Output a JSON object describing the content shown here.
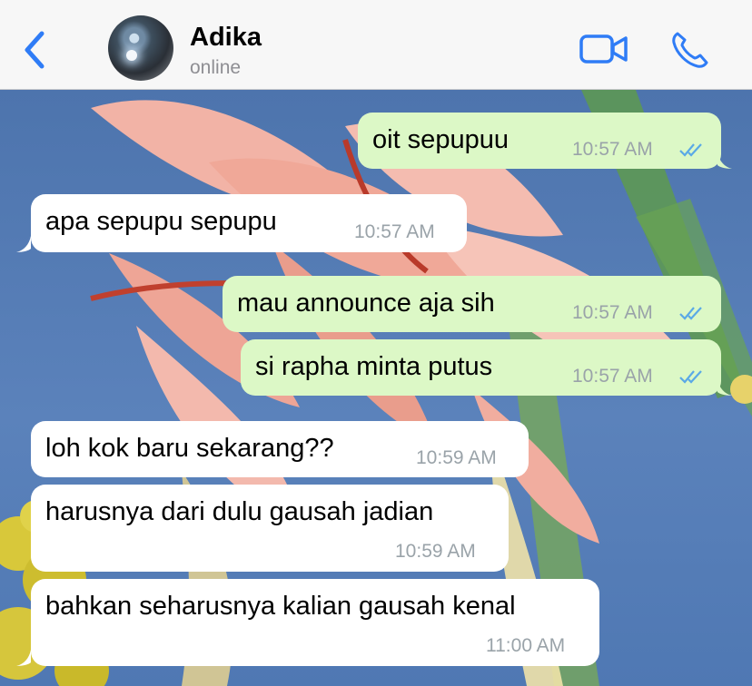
{
  "header": {
    "contact_name": "Adika",
    "contact_status": "online"
  },
  "icons": {
    "back": "chevron-left-icon",
    "video": "video-camera-icon",
    "call": "phone-icon",
    "read_receipt": "double-check-icon"
  },
  "colors": {
    "accent": "#2f7cf6",
    "outgoing_bubble": "#dcf8c6",
    "incoming_bubble": "#ffffff",
    "read_check": "#5aa9e6",
    "timestamp": "#9aa3a9"
  },
  "messages": [
    {
      "direction": "outgoing",
      "text": "oit sepupuu",
      "time": "10:57 AM",
      "read": true
    },
    {
      "direction": "incoming",
      "text": "apa sepupu sepupu",
      "time": "10:57 AM"
    },
    {
      "direction": "outgoing",
      "text": "mau announce aja sih",
      "time": "10:57 AM",
      "read": true
    },
    {
      "direction": "outgoing",
      "text": "si rapha minta putus",
      "time": "10:57 AM",
      "read": true
    },
    {
      "direction": "incoming",
      "text": "loh kok baru sekarang??",
      "time": "10:59 AM"
    },
    {
      "direction": "incoming",
      "text": "harusnya dari dulu gausah jadian",
      "time": "10:59 AM"
    },
    {
      "direction": "incoming",
      "text": "bahkan seharusnya kalian gausah kenal",
      "time": "11:00 AM"
    }
  ]
}
